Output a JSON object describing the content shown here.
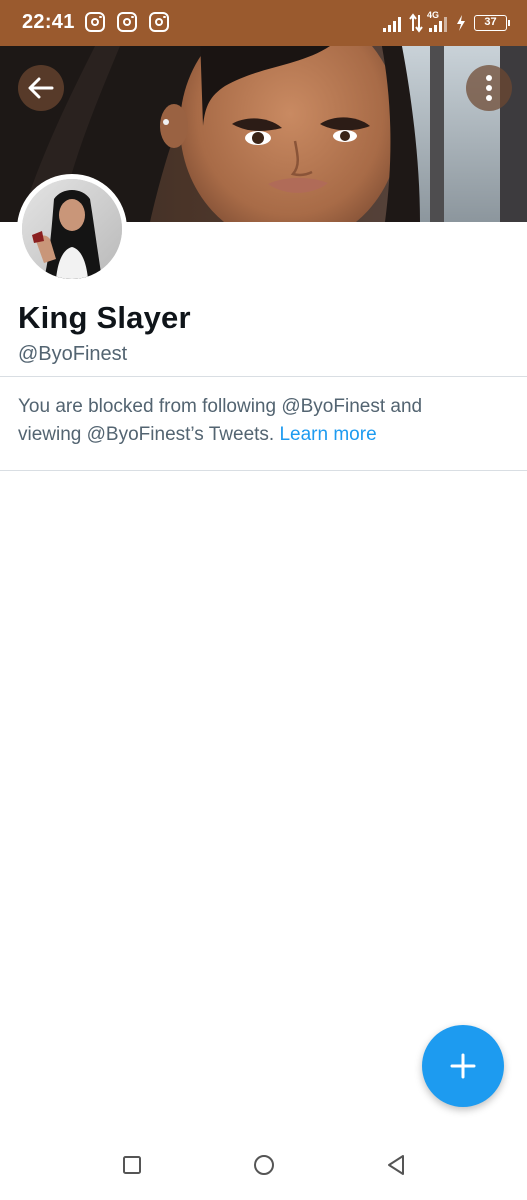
{
  "status_bar": {
    "time": "22:41",
    "notification_icons": [
      "instagram-icon",
      "instagram-icon",
      "instagram-icon"
    ],
    "network_label": "4G",
    "battery": "37",
    "background_color": "#9a5a2e"
  },
  "profile": {
    "display_name": "King Slayer",
    "handle": "@ByoFinest",
    "blocked_text": "You are blocked from following @ByoFinest and viewing @ByoFinest’s Tweets.",
    "learn_more": "Learn more"
  },
  "header_actions": {
    "back_icon": "arrow-left-icon",
    "more_icon": "more-vertical-icon"
  },
  "fab": {
    "icon": "plus-icon",
    "color": "#1d9bf0"
  },
  "nav": {
    "recents_icon": "square-icon",
    "home_icon": "circle-icon",
    "back_icon": "triangle-back-icon"
  },
  "colors": {
    "accent": "#1d9bf0",
    "text_primary": "#0f1419",
    "text_secondary": "#536471",
    "divider": "#d9dee3"
  }
}
